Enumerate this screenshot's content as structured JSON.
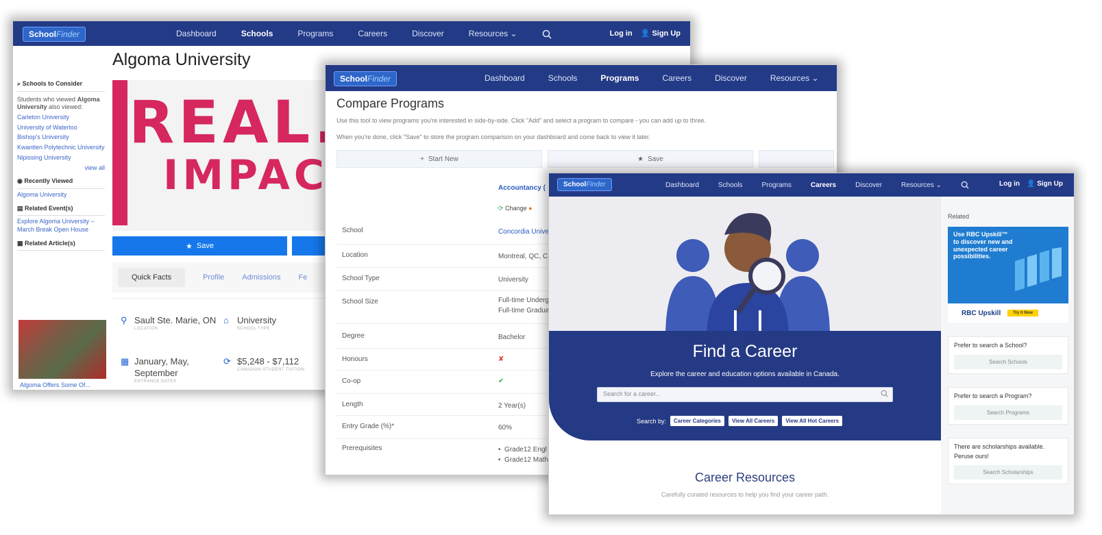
{
  "brand": {
    "logo_main": "School",
    "logo_sub": "Finder"
  },
  "w1": {
    "nav": [
      "Dashboard",
      "Schools",
      "Programs",
      "Careers",
      "Discover",
      "Resources"
    ],
    "login": "Log in",
    "signup": "Sign Up",
    "title": "Algoma University",
    "sidebar": {
      "schools_heading": "Schools to Consider",
      "intro_1": "Students who viewed",
      "intro_school": "Algoma University",
      "intro_2": "also viewed:",
      "schools": [
        "Carleton University",
        "University of Waterloo",
        "Bishop's University",
        "Kwantlen Polytechnic University",
        "Nipissing University"
      ],
      "view_all": "view all",
      "recent_heading": "Recently Viewed",
      "recent": [
        "Algoma University"
      ],
      "events_heading": "Related Event(s)",
      "events": [
        "Explore Algoma University – March Break Open House"
      ],
      "articles_heading": "Related Article(s)",
      "article_caption": "Algoma Offers Some Of..."
    },
    "hero_line1": "REAL.",
    "hero_line2": "IMPACT",
    "save_label": "Save",
    "tabs": [
      "Quick Facts",
      "Profile",
      "Admissions",
      "Fe"
    ],
    "facts": [
      {
        "value": "Sault Ste. Marie, ON",
        "label": "LOCATION"
      },
      {
        "value": "University",
        "label": "SCHOOL TYPE"
      },
      {
        "value": "January, May, September",
        "label": "ENTRANCE DATES"
      },
      {
        "value": "$5,248 - $7,112",
        "label": "CANADIAN STUDENT TUITION"
      }
    ]
  },
  "w2": {
    "nav": [
      "Dashboard",
      "Schools",
      "Programs",
      "Careers",
      "Discover",
      "Resources"
    ],
    "title": "Compare Programs",
    "desc1": "Use this tool to view programs you're interested in side-by-side. Click \"Add\" and select a program to compare - you can add up to three.",
    "desc2": "When you're done, click \"Save\" to store the program comparison on your dashboard and come back to view it later.",
    "start_new": "Start New",
    "save": "Save",
    "program_name": "Accountancy (",
    "change": "Change",
    "rows": [
      {
        "label": "School",
        "value": "Concordia Unive"
      },
      {
        "label": "Location",
        "value": "Montreal, QC, Ca"
      },
      {
        "label": "School Type",
        "value": "University"
      },
      {
        "label": "School Size",
        "value": "Full-time Undergr\nFull-time Gradua"
      },
      {
        "label": "Degree",
        "value": "Bachelor"
      },
      {
        "label": "Honours",
        "value": "✘"
      },
      {
        "label": "Co-op",
        "value": "✔"
      },
      {
        "label": "Length",
        "value": "2 Year(s)"
      },
      {
        "label": "Entry Grade (%)*",
        "value": "60%"
      },
      {
        "label": "Prerequisites",
        "value": "•  Grade12 Engl\n•  Grade12 Math"
      }
    ]
  },
  "w3": {
    "nav": [
      "Dashboard",
      "Schools",
      "Programs",
      "Careers",
      "Discover",
      "Resources"
    ],
    "login": "Log in",
    "signup": "Sign Up",
    "title": "Find a Career",
    "subtitle": "Explore the career and education options available in Canada.",
    "search_placeholder": "Search for a career...",
    "search_by": "Search by:",
    "buttons": [
      "Career Categories",
      "View All Careers",
      "View All Hot Careers"
    ],
    "resources_title": "Career Resources",
    "resources_sub": "Carefully curated resources to help you find your career path.",
    "side": {
      "related": "Related",
      "ad_text": "Use RBC Upskill™ to discover new and unexpected career possibilities.",
      "ad_brand": "RBC Upskill",
      "ad_cta": "Try it Now",
      "cards": [
        {
          "q": "Prefer to search a School?",
          "b": "Search Schools"
        },
        {
          "q": "Prefer to search a Program?",
          "b": "Search Programs"
        },
        {
          "q": "There are scholarships available. Peruse ours!",
          "b": "Search Scholarships"
        }
      ]
    }
  }
}
